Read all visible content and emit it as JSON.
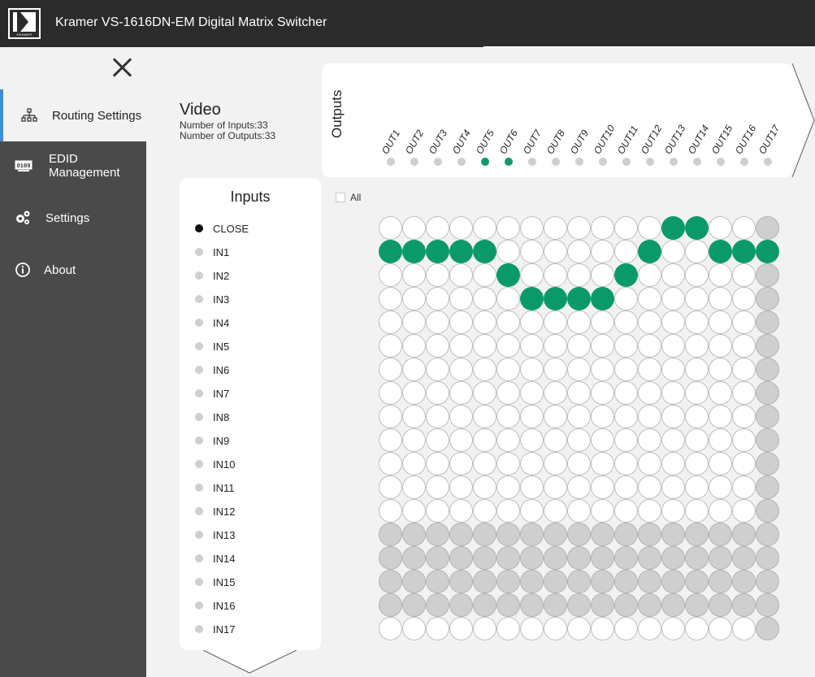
{
  "header": {
    "brand_label": "Kramer",
    "model": "VS-1616DN-EM Digital Matrix Switcher",
    "logo_text": "KRAMER"
  },
  "sidebar": {
    "items": [
      {
        "label": "Routing Settings",
        "icon": "sitemap-icon",
        "active": true
      },
      {
        "label": "EDID\nManagement",
        "icon": "edid-icon",
        "active": false
      },
      {
        "label": "Settings",
        "icon": "gears-icon",
        "active": false
      },
      {
        "label": "About",
        "icon": "info-icon",
        "active": false
      }
    ]
  },
  "video": {
    "title": "Video",
    "num_inputs": "Number of Inputs:33",
    "num_outputs": "Number of Outputs:33"
  },
  "outputs": {
    "label": "Outputs",
    "labels": [
      "OUT1",
      "OUT2",
      "OUT3",
      "OUT4",
      "OUT5",
      "OUT6",
      "OUT7",
      "OUT8",
      "OUT9",
      "OUT10",
      "OUT11",
      "OUT12",
      "OUT13",
      "OUT14",
      "OUT15",
      "OUT16",
      "OUT17"
    ],
    "selected": [
      5,
      6
    ]
  },
  "all_checkbox": {
    "label": "All",
    "checked": false
  },
  "inputs": {
    "title": "Inputs",
    "rows": [
      "CLOSE",
      "IN1",
      "IN2",
      "IN3",
      "IN4",
      "IN5",
      "IN6",
      "IN7",
      "IN8",
      "IN9",
      "IN10",
      "IN11",
      "IN12",
      "IN13",
      "IN14",
      "IN15",
      "IN16",
      "IN17"
    ]
  },
  "matrix": {
    "rows": 18,
    "cols": 17,
    "connected": {
      "0": [
        12,
        13
      ],
      "1": [
        0,
        1,
        2,
        3,
        4,
        11,
        14,
        15,
        16
      ],
      "2": [
        5,
        10
      ],
      "3": [
        6,
        7,
        8,
        9
      ]
    },
    "disabled_rows": [
      13,
      14,
      15,
      16
    ],
    "disabled_cols": [
      16
    ]
  },
  "colors": {
    "topbar": "#2b2b2b",
    "sidebar": "#4a4a4a",
    "accent_green": "#0a9a6a",
    "active_tab_border": "#3c8fd8"
  }
}
